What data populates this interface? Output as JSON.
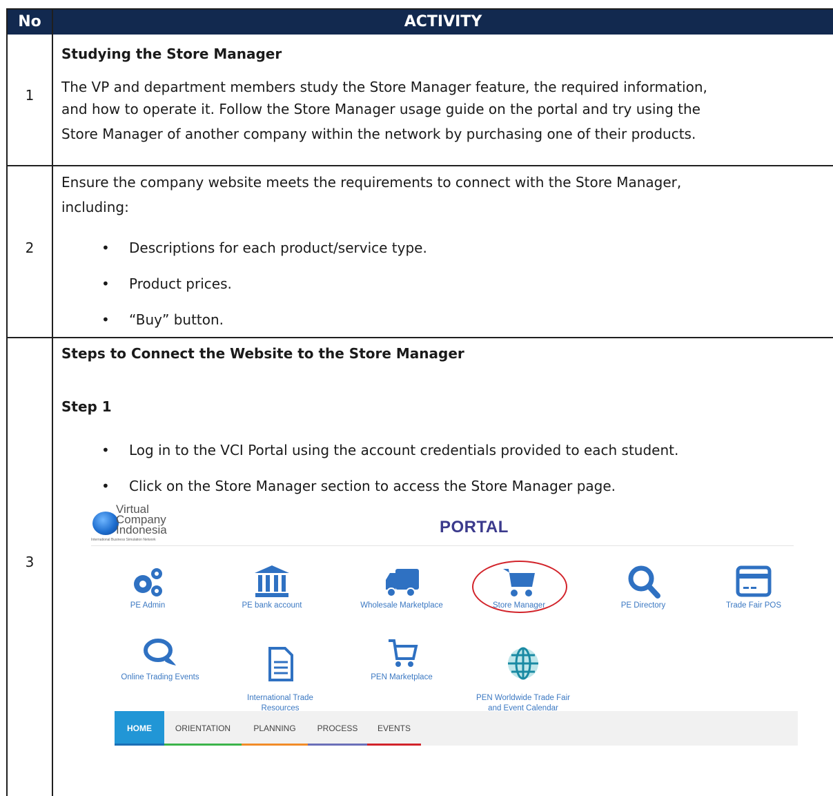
{
  "header": {
    "no": "No",
    "activity": "ACTIVITY"
  },
  "rows": [
    {
      "no": "1",
      "title": "Studying the Store Manager",
      "body": [
        "The VP and department members study the Store Manager feature, the required information,",
        "and how to operate it. Follow the Store Manager usage guide on the portal and try using the",
        "Store Manager of another company within the network by purchasing one of their products."
      ]
    },
    {
      "no": "2",
      "body": [
        "Ensure the company website meets the requirements to connect with the Store Manager,",
        "including:"
      ],
      "bullets": [
        "Descriptions for each product/service type.",
        "Product prices.",
        "“Buy” button."
      ]
    },
    {
      "no": "3",
      "title": "Steps to Connect the Website to the Store Manager",
      "step": "Step 1",
      "bullets": [
        "Log in to the VCI Portal using the account credentials provided to each student.",
        "Click on the Store Manager section to access the Store Manager page."
      ]
    }
  ],
  "portal": {
    "logo_lines": [
      "Virtual",
      "Company",
      "Indonesia"
    ],
    "logo_sub": "International Business Simulation Network",
    "title": "PORTAL",
    "apps_row1": [
      "PE Admin",
      "PE bank account",
      "Wholesale Marketplace",
      "Store Manager",
      "PE Directory",
      "Trade Fair POS"
    ],
    "apps_row2": [
      "Online Trading Events",
      "International Trade\nResources",
      "PEN Marketplace",
      "PEN Worldwide Trade Fair\nand Event Calendar"
    ],
    "nav": [
      "HOME",
      "ORIENTATION",
      "PLANNING",
      "PROCESS",
      "EVENTS"
    ],
    "accent": "#3b78c2",
    "highlight_color": "#d2232a"
  }
}
